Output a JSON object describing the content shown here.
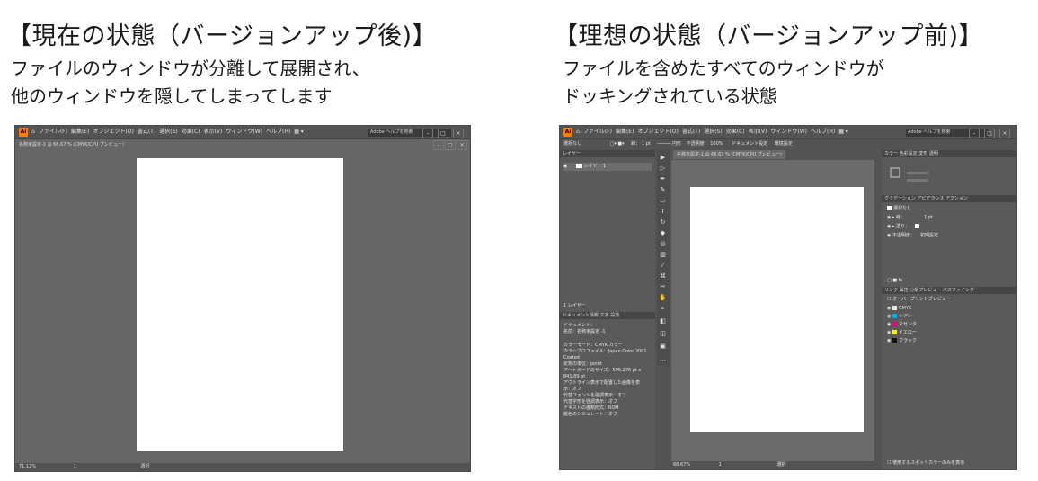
{
  "left": {
    "title": "【現在の状態（バージョンアップ後)】",
    "desc_lines": [
      "ファイルのウィンドウが分離して展開され、",
      "他のウィンドウを隠してしまってします"
    ],
    "menu": [
      "ファイル(F)",
      "編集(E)",
      "オブジェクト(O)",
      "書式(T)",
      "選択(S)",
      "効果(C)",
      "表示(V)",
      "ウィンドウ(W)",
      "ヘルプ(H)"
    ],
    "search_placeholder": "Adobe ヘルプを検索",
    "doc_tab": "名称未設定-1 @ 66.67 % (CMYK/CPU プレビュー)",
    "zoom": "71.12%",
    "page": "1",
    "tool_label": "選択"
  },
  "right": {
    "title": "【理想の状態（バージョンアップ前)】",
    "desc_lines": [
      "ファイルを含めたすべてのウィンドウが",
      "ドッキングされている状態"
    ],
    "menu": [
      "ファイル(F)",
      "編集(E)",
      "オブジェクト(O)",
      "書式(T)",
      "選択(S)",
      "効果(C)",
      "表示(V)",
      "ウィンドウ(W)",
      "ヘルプ(H)"
    ],
    "search_placeholder": "Adobe ヘルプを検索",
    "control": {
      "selection": "選択なし",
      "stroke_label": "線：",
      "stroke_value": "1 pt",
      "style": "円形",
      "opacity_label": "不透明度：",
      "opacity": "100%",
      "doc_settings": "ドキュメント設定",
      "prefs": "環境設定"
    },
    "doc_tab": "名称未設定-1 @ 66.67 % (CMYK/CPU プレビュー)",
    "layers": {
      "header": "レイヤー",
      "layer_name": "レイヤー 1",
      "footer": "1 レイヤー"
    },
    "info_tabs": [
      "ドキュメント情報",
      "文字",
      "段落"
    ],
    "doc_info": [
      "ドキュメント：",
      "名前：名称未設定 -1",
      "カラーモード：CMYK カラー",
      "カラープロファイル：Japan Color 2001",
      "Coated",
      "定規の単位：point",
      "アートボードのサイズ：595.276 pt x",
      "841.89 pt",
      "アウトライン表示で配置した画像を表",
      "示：オフ",
      "代替フォントを強調表示：オフ",
      "代替字形を強調表示：オフ",
      "テキストの書類形式：ROM",
      "紙色のシミュレート：オフ"
    ],
    "color_tabs": [
      "カラー",
      "色彩設定",
      "変形",
      "透明"
    ],
    "appearance_tabs": [
      "グラデーション",
      "アピアランス",
      "アクション"
    ],
    "appearance": {
      "title": "選択なし",
      "stroke": "線：",
      "stroke_value": "1 pt",
      "fill": "塗り：",
      "opacity": "不透明度：",
      "opacity_value": "初期設定"
    },
    "separation_tabs": [
      "リンク",
      "属性",
      "分版プレビュー",
      "パスファインダー"
    ],
    "overprint": "オーバープリントプレビュー",
    "inks": [
      {
        "name": "CMYK",
        "color": "#e8e8e8"
      },
      {
        "name": "シアン",
        "color": "#00aeef"
      },
      {
        "name": "マゼンタ",
        "color": "#ec008c"
      },
      {
        "name": "イエロー",
        "color": "#fff200"
      },
      {
        "name": "ブラック",
        "color": "#111111"
      }
    ],
    "spot_footer": "使用するスポットカラーのみを表示",
    "zoom": "66.67%",
    "page": "1",
    "tool_label": "選択"
  }
}
